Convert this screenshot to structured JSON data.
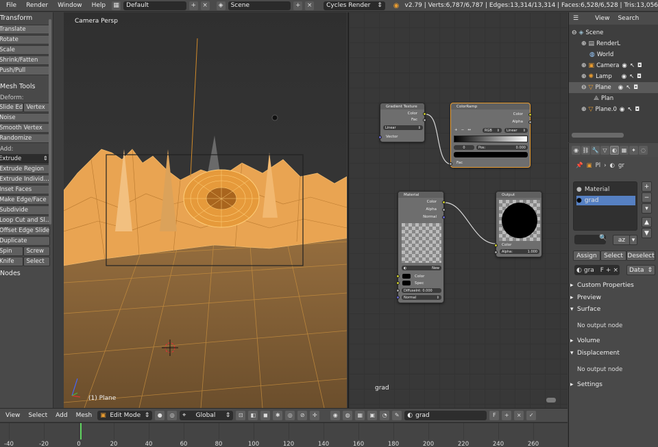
{
  "topbar": {
    "menus": [
      "File",
      "Render",
      "Window",
      "Help"
    ],
    "layout": "Default",
    "scene": "Scene",
    "engine": "Cycles Render",
    "stats": "v2.79 | Verts:6,787/6,787 | Edges:13,314/13,314 | Faces:6,528/6,528 | Tris:13,056"
  },
  "toolshelf": {
    "transform_title": "Transform",
    "transform_tools": [
      "Translate",
      "Rotate",
      "Scale",
      "Shrink/Fatten",
      "Push/Pull"
    ],
    "mesh_tools_title": "Mesh Tools",
    "deform_label": "Deform:",
    "slide_edge": "Slide Ed",
    "vertex": "Vertex",
    "noise": "Noise",
    "smooth_vertex": "Smooth Vertex",
    "randomize": "Randomize",
    "add_label": "Add:",
    "extrude_select": "Extrude",
    "add_tools": [
      "Extrude Region",
      "Extrude Individ…",
      "Inset Faces",
      "Make Edge/Face",
      "Subdivide",
      "Loop Cut and Sl…",
      "Offset Edge Slide",
      "Duplicate"
    ],
    "spin": "Spin",
    "screw": "Screw",
    "knife": "Knife",
    "select": "Select",
    "nodes_title": "Nodes"
  },
  "viewport": {
    "title": "Camera Persp",
    "object_label": "(1) Plane"
  },
  "nodes": {
    "gradient": {
      "title": "Gradient Texture",
      "color": "Color",
      "fac": "Fac",
      "type": "Linear",
      "vector": "Vector"
    },
    "colorramp": {
      "title": "ColorRamp",
      "color": "Color",
      "alpha": "Alpha",
      "mode": "RGB",
      "interp": "Linear",
      "index": "0",
      "pos_label": "Pos:",
      "pos_value": "0.000",
      "fac": "Fac"
    },
    "material": {
      "title": "Material",
      "color": "Color",
      "alpha": "Alpha",
      "normal": "Normal",
      "new": "New",
      "color_in": "Color",
      "spec": "Spec",
      "diffuse": "DiffuseInt: 0.000",
      "normal_in": "Normal"
    },
    "output": {
      "title": "Output",
      "color": "Color",
      "alpha_label": "Alpha:",
      "alpha_value": "1.000"
    },
    "editor_label": "grad"
  },
  "outliner": {
    "menus": [
      "View",
      "Search"
    ],
    "items": [
      {
        "label": "Scene",
        "icon": "scene-icon"
      },
      {
        "label": "RenderL",
        "icon": "render-layers-icon"
      },
      {
        "label": "World",
        "icon": "world-icon"
      },
      {
        "label": "Camera",
        "icon": "camera-icon"
      },
      {
        "label": "Lamp",
        "icon": "lamp-icon"
      },
      {
        "label": "Plane",
        "icon": "mesh-icon"
      },
      {
        "label": "Plan",
        "icon": "mesh-data-icon"
      },
      {
        "label": "Plane.0",
        "icon": "mesh-icon"
      }
    ]
  },
  "properties": {
    "breadcrumb_object": "Pl",
    "breadcrumb_material": "gr",
    "slots": [
      "Material",
      "grad"
    ],
    "assign": "Assign",
    "select": "Select",
    "deselect": "Deselect",
    "material_name": "gra",
    "fake_user": "F",
    "data_mode": "Data",
    "sections": [
      "Custom Properties",
      "Preview",
      "Surface",
      "Volume",
      "Displacement",
      "Settings"
    ],
    "no_output": "No output node",
    "no_output_2": "No output node"
  },
  "bottom": {
    "menus": [
      "View",
      "Select",
      "Add",
      "Mesh"
    ],
    "mode": "Edit Mode",
    "orientation": "Global",
    "material": "grad",
    "fake_user": "F"
  },
  "timeline": {
    "ticks": [
      "-40",
      "-20",
      "0",
      "20",
      "40",
      "60",
      "80",
      "100",
      "120",
      "140",
      "160",
      "180",
      "200",
      "220",
      "240",
      "260"
    ],
    "current_frame": 1
  },
  "colors": {
    "accent": "#e89b2f",
    "selection": "#5680c2",
    "mesh_orange": "#f0a646"
  }
}
